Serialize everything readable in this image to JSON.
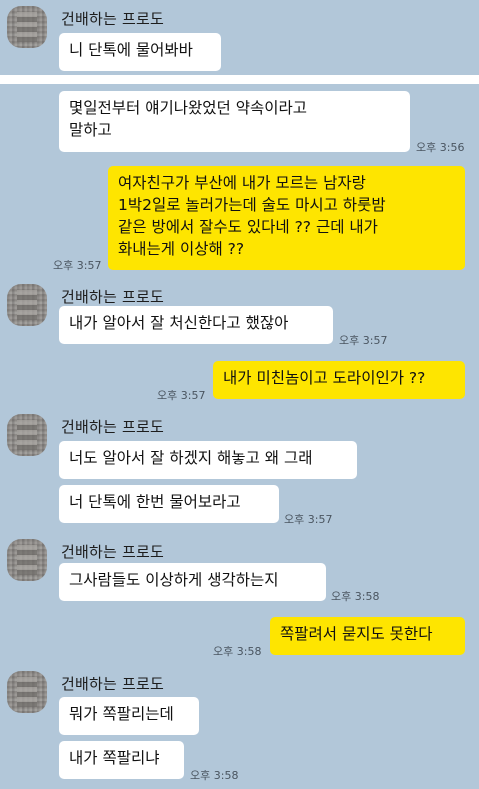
{
  "chat": {
    "friend_name": "건배하는 프로도",
    "messages": [
      {
        "text": "니 단톡에 물어봐바"
      },
      {
        "text": "몇일전부터 얘기나왔었던 약속이라고\n말하고",
        "time": "오후 3:56"
      },
      {
        "text": "여자친구가 부산에 내가 모르는 남자랑\n1박2일로 놀러가는데 술도 마시고 하룻밤\n같은 방에서 잘수도 있다네 ?? 근데 내가\n화내는게 이상해 ??",
        "time": "오후 3:57"
      },
      {
        "text": "내가 알아서 잘 처신한다고 했잖아",
        "time": "오후 3:57"
      },
      {
        "text": "내가 미친놈이고 도라이인가 ??",
        "time": "오후 3:57"
      },
      {
        "text": "너도 알아서 잘 하겠지 해놓고 왜 그래"
      },
      {
        "text": "너 단톡에 한번 물어보라고",
        "time": "오후 3:57"
      },
      {
        "text": "그사람들도 이상하게 생각하는지",
        "time": "오후 3:58"
      },
      {
        "text": "쪽팔려서 묻지도 못한다",
        "time": "오후 3:58"
      },
      {
        "text": "뭐가 쪽팔리는데"
      },
      {
        "text": "내가 쪽팔리냐",
        "time": "오후 3:58"
      }
    ]
  },
  "colors": {
    "background": "#b2c7d9",
    "incoming_bubble": "#ffffff",
    "outgoing_bubble": "#fee500"
  }
}
